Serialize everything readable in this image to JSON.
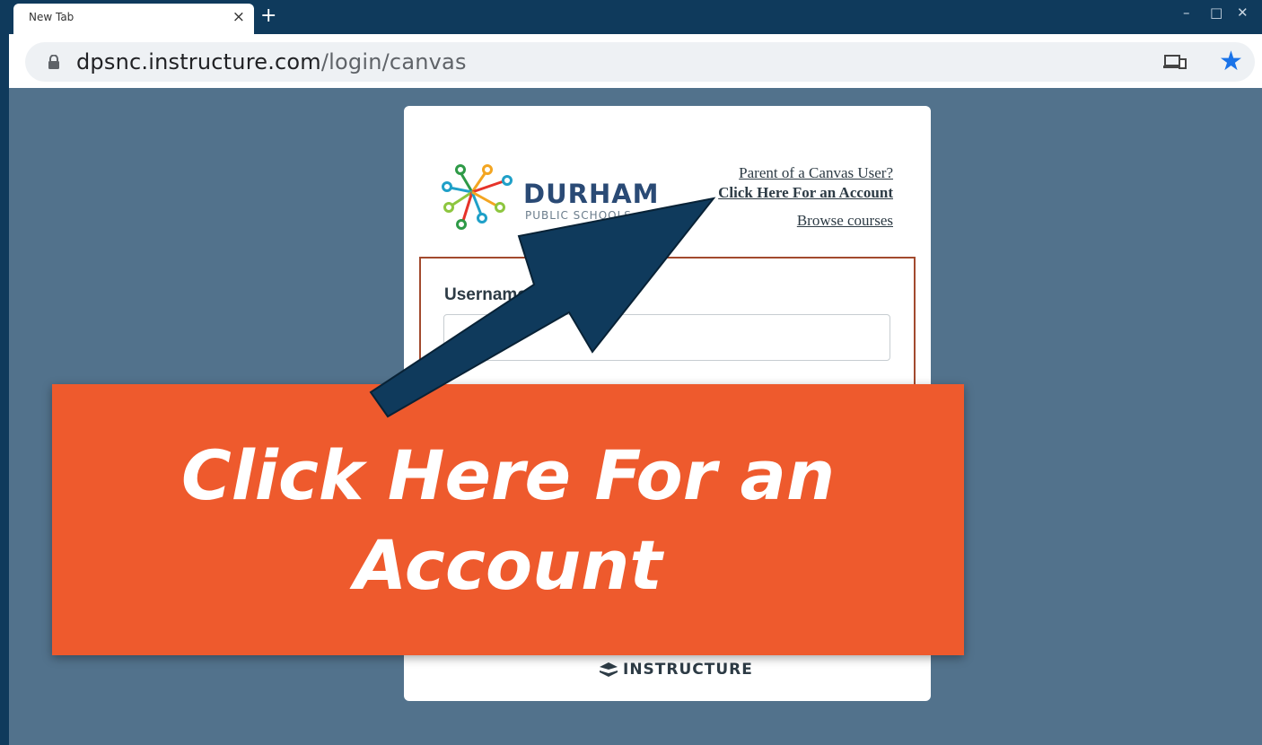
{
  "browser": {
    "tab_title": "New Tab",
    "tab_close": "×",
    "new_tab": "+",
    "window_controls": [
      "–",
      "□",
      "✕"
    ],
    "url_domain": "dpsnc.instructure.com",
    "url_path": "/login/canvas",
    "icons": [
      "lock-icon",
      "cast-icon",
      "bookmark-star-icon"
    ],
    "accent": "#1a73e8"
  },
  "login": {
    "logo": {
      "name": "DURHAM",
      "subtitle": "PUBLIC SCHOOLS"
    },
    "parent_link_line1": "Parent of a Canvas User?",
    "parent_link_line2": "Click Here For an Account",
    "browse_courses": "Browse courses",
    "username_label": "Username",
    "username_value": "",
    "footer_brand": "INSTRUCTURE"
  },
  "callout": {
    "line1": "Click Here For an",
    "line2": "Account",
    "color": "#ee5a2d",
    "arrow_color": "#0f3a5c"
  }
}
